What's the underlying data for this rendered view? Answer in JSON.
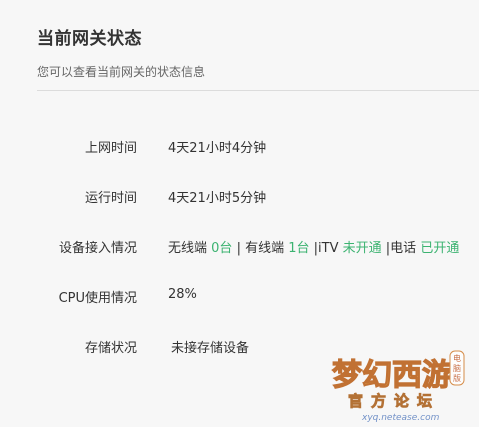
{
  "header": {
    "title": "当前网关状态",
    "subtitle": "您可以查看当前网关的状态信息"
  },
  "status": {
    "online_time": {
      "label": "上网时间",
      "value": "4天21小时4分钟"
    },
    "run_time": {
      "label": "运行时间",
      "value": "4天21小时5分钟"
    },
    "devices": {
      "label": "设备接入情况",
      "wireless_label": "无线端",
      "wireless_count": "0台",
      "sep1": " | ",
      "wired_label": "有线端",
      "wired_count": "1台",
      "sep2": "  |",
      "itv_label": "iTV",
      "itv_status": "未开通",
      "sep3": " |",
      "phone_label": "电话",
      "phone_status": "已开通"
    },
    "cpu": {
      "label": "CPU使用情况",
      "value": "28%"
    },
    "storage": {
      "label": "存储状况",
      "value": "未接存储设备"
    }
  },
  "watermark": {
    "logo_text": "梦幻西游",
    "badge_text": "电脑版",
    "subtitle": "官方论坛",
    "url": "xyq.netease.com"
  },
  "colors": {
    "accent_green": "#3cb371",
    "text": "#333333",
    "subtext": "#666666",
    "background": "#f7f7f7"
  }
}
